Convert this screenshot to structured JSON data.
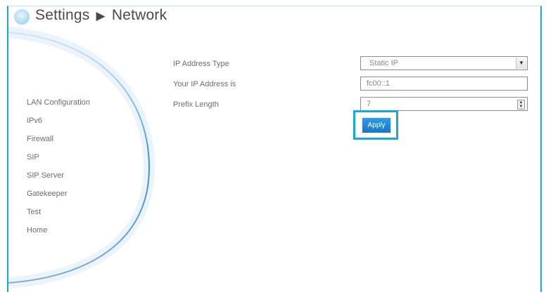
{
  "header": {
    "section": "Settings",
    "separator": "▶",
    "page": "Network"
  },
  "sidebar": {
    "items": [
      {
        "label": "LAN Configuration"
      },
      {
        "label": "IPv6"
      },
      {
        "label": "Firewall"
      },
      {
        "label": "SIP"
      },
      {
        "label": "SIP Server"
      },
      {
        "label": "Gatekeeper"
      },
      {
        "label": "Test"
      },
      {
        "label": "Home"
      }
    ]
  },
  "form": {
    "ip_type_label": "IP Address Type",
    "ip_type_value": "Static IP",
    "ip_address_label": "Your IP Address is",
    "ip_address_value": "fc00::1",
    "prefix_label": "Prefix Length",
    "prefix_value": "7",
    "apply_label": "Apply"
  },
  "colors": {
    "accent": "#1aa7de",
    "button": "#1677cc"
  },
  "icons": {
    "logo": "globe-logo-icon",
    "select": "chevron-down-icon",
    "spinner": "spinner-arrows-icon"
  }
}
